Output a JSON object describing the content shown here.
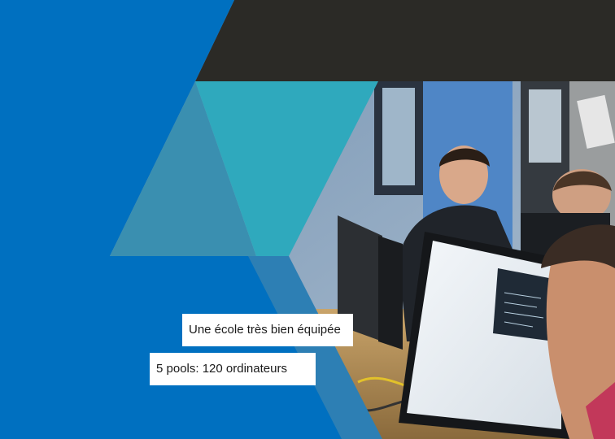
{
  "captions": {
    "equipment": "Une école très bien équipée",
    "pools": "5 pools: 120 ordinateurs"
  },
  "colors": {
    "brand_blue": "#0070c0",
    "dark_band": "#2b2a26",
    "teal": "#2fa9bd",
    "slate_blue": "#3a8fb0",
    "caption_bg": "#ffffff"
  },
  "photo": {
    "subject": "students working at computer monitors in a classroom"
  }
}
